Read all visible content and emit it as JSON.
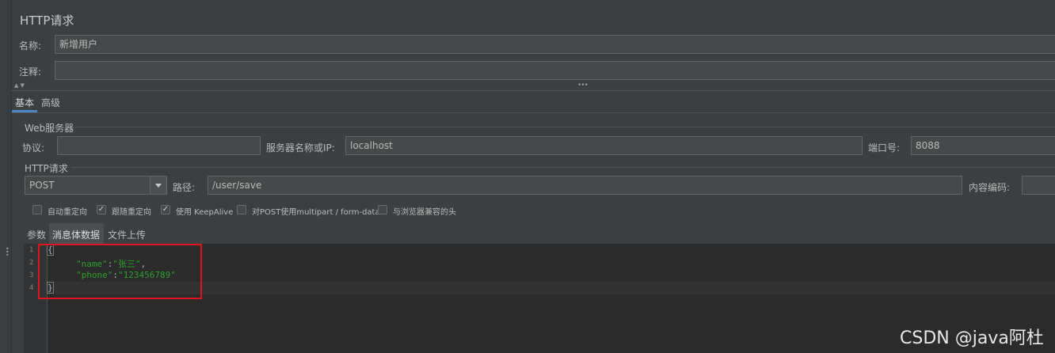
{
  "title": "HTTP请求",
  "name_label": "名称:",
  "name_value": "新增用户",
  "comment_label": "注释:",
  "comment_value": "",
  "tabs": [
    {
      "label": "基本"
    },
    {
      "label": "高级"
    }
  ],
  "web_server": {
    "section_label": "Web服务器",
    "protocol_label": "协议:",
    "protocol_value": "",
    "server_label": "服务器名称或IP:",
    "server_value": "localhost",
    "port_label": "端口号:",
    "port_value": "8088"
  },
  "http_request": {
    "section_label": "HTTP请求",
    "method": "POST",
    "path_label": "路径:",
    "path_value": "/user/save",
    "encoding_label": "内容编码:",
    "encoding_value": ""
  },
  "options": [
    {
      "label": "自动重定向",
      "checked": false
    },
    {
      "label": "跟随重定向",
      "checked": true
    },
    {
      "label": "使用 KeepAlive",
      "checked": true
    },
    {
      "label": "对POST使用multipart / form-data",
      "checked": false
    },
    {
      "label": "与浏览器兼容的头",
      "checked": false
    }
  ],
  "body_tabs": [
    {
      "label": "参数",
      "active": false
    },
    {
      "label": "消息体数据",
      "active": true
    },
    {
      "label": "文件上传",
      "active": false
    }
  ],
  "editor": {
    "line_numbers": [
      "1",
      "2",
      "3",
      "4"
    ],
    "brace_open": "{",
    "brace_close": "}",
    "name_key": "\"name\"",
    "name_value": "\"张三\"",
    "phone_key": "\"phone\"",
    "phone_value": "\"123456789\"",
    "colon": ":",
    "comma": ","
  },
  "watermark": "CSDN @java阿杜",
  "colors": {
    "background": "#3c3f41",
    "field": "#45494a",
    "editor": "#2b2b2b",
    "json_green": "#2fa02f",
    "highlight_red": "#e0141e",
    "tab_underline": "#4a88c7"
  }
}
